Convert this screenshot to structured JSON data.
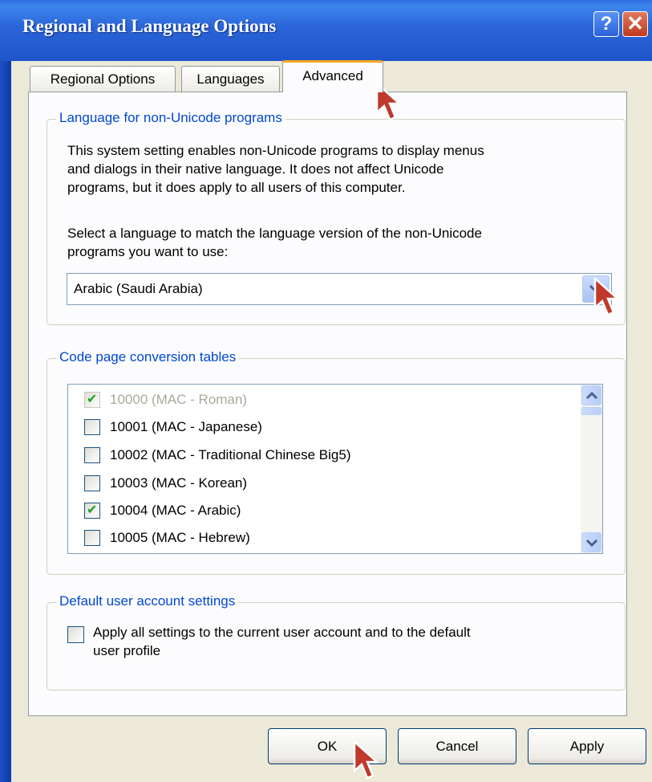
{
  "window": {
    "title": "Regional and Language Options",
    "help_icon": "?",
    "close_icon": "✕"
  },
  "tabs": [
    {
      "label": "Regional Options",
      "active": false
    },
    {
      "label": "Languages",
      "active": false
    },
    {
      "label": "Advanced",
      "active": true
    }
  ],
  "non_unicode": {
    "legend": "Language for non-Unicode programs",
    "description_lines": [
      "This system setting enables non-Unicode programs to display menus",
      "and dialogs in their native language. It does not affect Unicode",
      "programs, but it does apply to all users of this computer."
    ],
    "instruction_lines": [
      "Select a language to match the language version of the non-Unicode",
      "programs you want to use:"
    ],
    "selected_language": "Arabic (Saudi Arabia)"
  },
  "code_pages": {
    "legend": "Code page conversion tables",
    "items": [
      {
        "label": "10000 (MAC - Roman)",
        "checked": true,
        "disabled": true
      },
      {
        "label": "10001 (MAC - Japanese)",
        "checked": false,
        "disabled": false
      },
      {
        "label": "10002 (MAC - Traditional Chinese Big5)",
        "checked": false,
        "disabled": false
      },
      {
        "label": "10003 (MAC - Korean)",
        "checked": false,
        "disabled": false
      },
      {
        "label": "10004 (MAC - Arabic)",
        "checked": true,
        "disabled": false
      },
      {
        "label": "10005 (MAC - Hebrew)",
        "checked": false,
        "disabled": false
      }
    ]
  },
  "default_user": {
    "legend": "Default user account settings",
    "checkbox_lines": [
      "Apply all settings to the current user account and to the default",
      "user profile"
    ],
    "checked": false
  },
  "buttons": {
    "ok": "OK",
    "cancel": "Cancel",
    "apply": "Apply"
  },
  "colors": {
    "title_bar": "#2a64d8",
    "legend_text": "#0046d5",
    "active_tab_accent": "#f5a623",
    "check_mark": "#21a121",
    "cursor_fill": "#c0392b"
  }
}
